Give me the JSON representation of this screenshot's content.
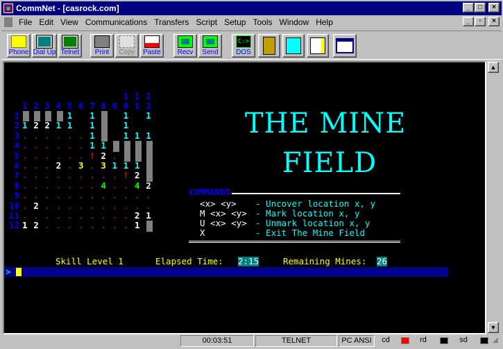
{
  "window": {
    "title": "CommNet - [casrock.com]"
  },
  "menu": [
    "File",
    "Edit",
    "View",
    "Communications",
    "Transfers",
    "Script",
    "Setup",
    "Tools",
    "Window",
    "Help"
  ],
  "toolbar": {
    "phone": "Phone",
    "dialup": "Dial Up",
    "telnet": "Telnet",
    "print": "Print",
    "copy": "Copy",
    "paste": "Paste",
    "recv": "Recv",
    "send": "Send",
    "dos": "DOS"
  },
  "game": {
    "title_top": "THE MINE",
    "title_bottom": "FIELD",
    "col_tens": [
      "1",
      "1",
      "1"
    ],
    "col_ones": [
      "1",
      "2",
      "3",
      "4",
      "5",
      "6",
      "7",
      "8",
      "9",
      "0",
      "1",
      "2"
    ],
    "row_labels": [
      "1",
      "2",
      "3",
      "4",
      "5",
      "6",
      "7",
      "8",
      "9",
      "10",
      "11",
      "12"
    ],
    "grid": [
      [
        "#",
        "#",
        "#",
        "#",
        "1",
        "",
        "1",
        "#",
        "",
        "1",
        "",
        "1"
      ],
      [
        "1",
        "2",
        "2",
        "1",
        "1",
        "",
        "1",
        "#",
        "",
        "1",
        "",
        ""
      ],
      [
        ".",
        ".",
        ".",
        ".",
        ".",
        ".",
        "1",
        "#",
        "",
        "1",
        "1",
        "1"
      ],
      [
        ".",
        ".",
        ".",
        ".",
        ".",
        ".",
        "1",
        "1",
        "#",
        "#",
        "#",
        "#"
      ],
      [
        ".",
        ".",
        ".",
        ".",
        ".",
        ".",
        "!",
        "2",
        ".",
        "#",
        "#",
        "#"
      ],
      [
        ".",
        ".",
        ".",
        "2",
        ".",
        "3",
        ".",
        "3",
        "1",
        "1",
        "1",
        "#"
      ],
      [
        ".",
        ".",
        ".",
        ".",
        ".",
        ".",
        ".",
        ".",
        ".",
        "!",
        "2",
        "#"
      ],
      [
        ".",
        ".",
        ".",
        ".",
        ".",
        ".",
        ".",
        "4",
        ".",
        ".",
        "4",
        "2"
      ],
      [
        ".",
        ".",
        ".",
        ".",
        ".",
        ".",
        ".",
        ".",
        ".",
        ".",
        ".",
        "."
      ],
      [
        ".",
        "2",
        ".",
        ".",
        ".",
        ".",
        ".",
        ".",
        ".",
        ".",
        ".",
        "."
      ],
      [
        ".",
        ".",
        ".",
        ".",
        ".",
        ".",
        ".",
        ".",
        ".",
        ".",
        "2",
        "1"
      ],
      [
        "1",
        "2",
        ".",
        ".",
        ".",
        ".",
        ".",
        ".",
        ".",
        ".",
        "1",
        "#"
      ]
    ],
    "commands_header": "COMMANDS",
    "commands": [
      {
        "key": "<x> <y>",
        "desc": "Uncover location x, y"
      },
      {
        "key": "M <x> <y>",
        "desc": "Mark location x, y"
      },
      {
        "key": "U <x> <y>",
        "desc": "Unmark location x, y"
      },
      {
        "key": "X",
        "desc": "Exit The Mine Field"
      }
    ],
    "skill_label": "Skill Level 1",
    "elapsed_label": "Elapsed Time:",
    "elapsed_value": "2:15",
    "remaining_label": "Remaining Mines:",
    "remaining_value": "26",
    "prompt": ">"
  },
  "status": {
    "timer": "00:03:51",
    "mode": "TELNET",
    "charset": "PC ANSI",
    "cd": "cd",
    "rd": "rd",
    "sd": "sd"
  },
  "colors": {
    "cyan": "#00ffff",
    "blue": "#0000ff",
    "yellow": "#ffff00",
    "white": "#ffffff",
    "green": "#00ff00",
    "red": "#ff0000",
    "magenta": "#800080",
    "navy": "#000080",
    "bar": "#00008b"
  }
}
